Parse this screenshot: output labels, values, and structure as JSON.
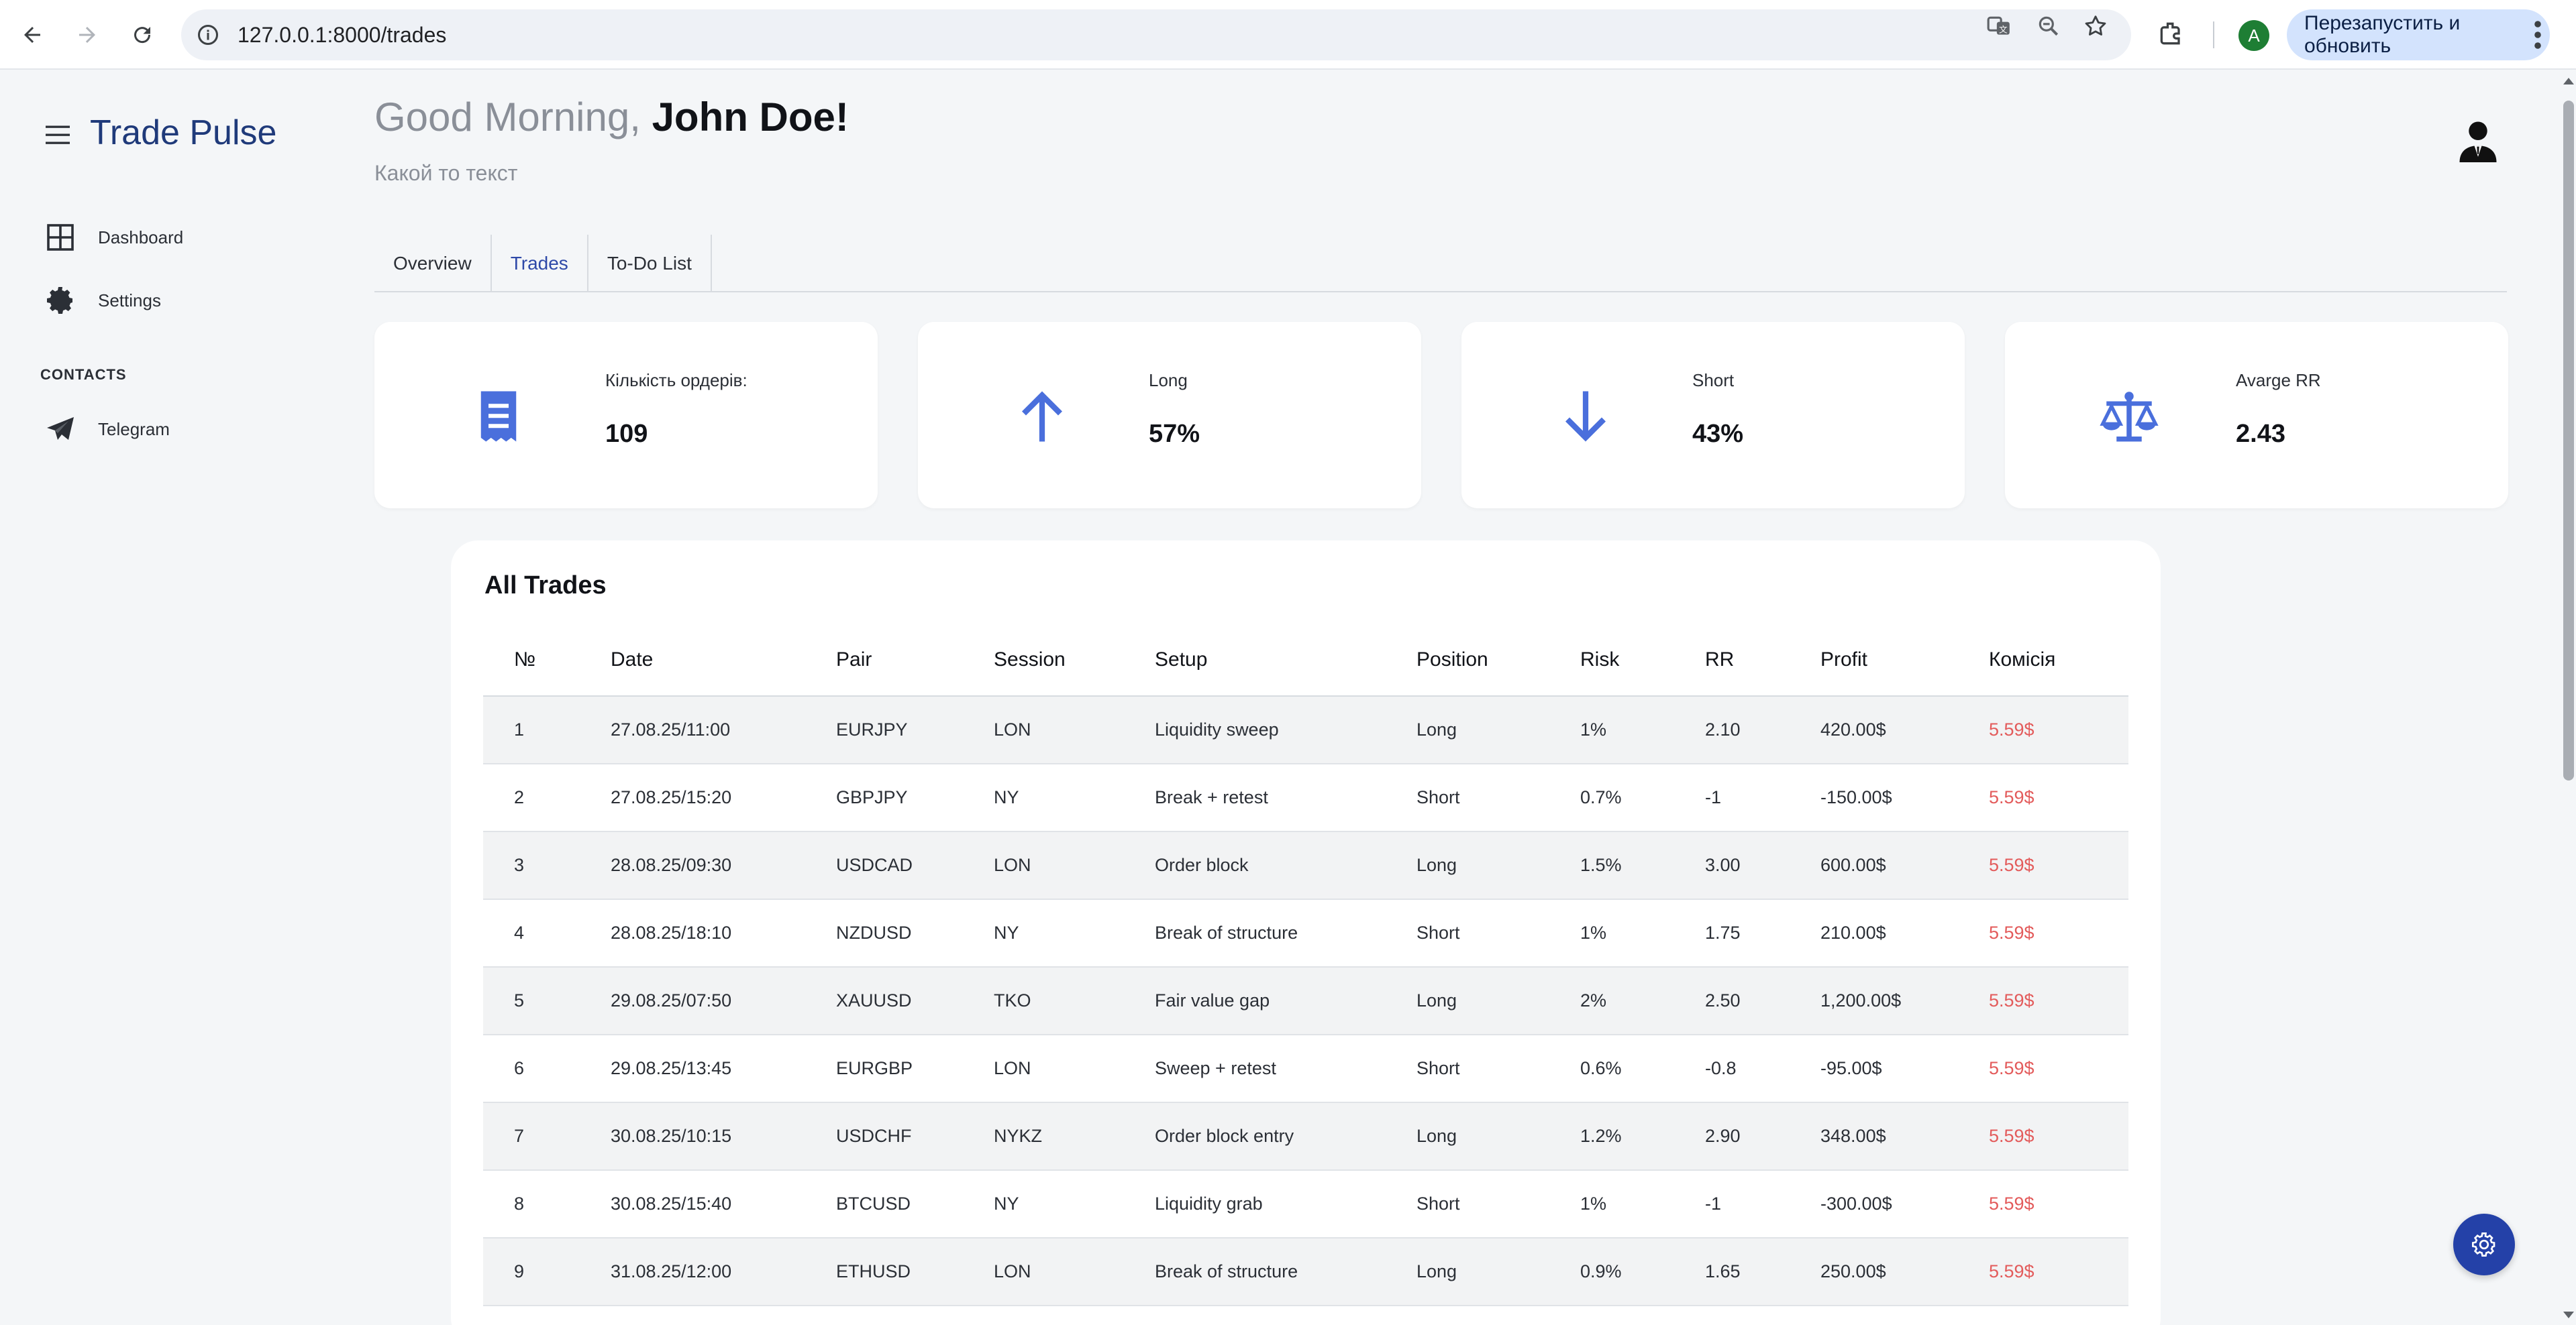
{
  "browser": {
    "url": "127.0.0.1:8000/trades",
    "profile_initial": "A",
    "update_button": "Перезапустить и обновить"
  },
  "sidebar": {
    "brand": "Trade Pulse",
    "items": [
      {
        "label": "Dashboard",
        "icon": "dashboard-icon"
      },
      {
        "label": "Settings",
        "icon": "gear-icon"
      }
    ],
    "contacts_heading": "CONTACTS",
    "contacts": [
      {
        "label": "Telegram",
        "icon": "telegram-icon"
      }
    ]
  },
  "header": {
    "greeting": "Good Morning, ",
    "user_name": "John Doe!",
    "subtitle": "Какой то текст"
  },
  "tabs": [
    {
      "label": "Overview",
      "active": false
    },
    {
      "label": "Trades",
      "active": true
    },
    {
      "label": "To-Do List",
      "active": false
    }
  ],
  "stats": [
    {
      "label": "Кількість ордерів:",
      "value": "109",
      "icon": "receipt-icon"
    },
    {
      "label": "Long",
      "value": "57%",
      "icon": "arrow-up-icon"
    },
    {
      "label": "Short",
      "value": "43%",
      "icon": "arrow-down-icon"
    },
    {
      "label": "Avarge RR",
      "value": "2.43",
      "icon": "scales-icon"
    }
  ],
  "trades": {
    "title": "All Trades",
    "columns": [
      "№",
      "Date",
      "Pair",
      "Session",
      "Setup",
      "Position",
      "Risk",
      "RR",
      "Profit",
      "Комісія"
    ],
    "rows": [
      [
        "1",
        "27.08.25/11:00",
        "EURJPY",
        "LON",
        "Liquidity sweep",
        "Long",
        "1%",
        "2.10",
        "420.00$",
        "5.59$"
      ],
      [
        "2",
        "27.08.25/15:20",
        "GBPJPY",
        "NY",
        "Break + retest",
        "Short",
        "0.7%",
        "-1",
        "-150.00$",
        "5.59$"
      ],
      [
        "3",
        "28.08.25/09:30",
        "USDCAD",
        "LON",
        "Order block",
        "Long",
        "1.5%",
        "3.00",
        "600.00$",
        "5.59$"
      ],
      [
        "4",
        "28.08.25/18:10",
        "NZDUSD",
        "NY",
        "Break of structure",
        "Short",
        "1%",
        "1.75",
        "210.00$",
        "5.59$"
      ],
      [
        "5",
        "29.08.25/07:50",
        "XAUUSD",
        "TKO",
        "Fair value gap",
        "Long",
        "2%",
        "2.50",
        "1,200.00$",
        "5.59$"
      ],
      [
        "6",
        "29.08.25/13:45",
        "EURGBP",
        "LON",
        "Sweep + retest",
        "Short",
        "0.6%",
        "-0.8",
        "-95.00$",
        "5.59$"
      ],
      [
        "7",
        "30.08.25/10:15",
        "USDCHF",
        "NYKZ",
        "Order block entry",
        "Long",
        "1.2%",
        "2.90",
        "348.00$",
        "5.59$"
      ],
      [
        "8",
        "30.08.25/15:40",
        "BTCUSD",
        "NY",
        "Liquidity grab",
        "Short",
        "1%",
        "-1",
        "-300.00$",
        "5.59$"
      ],
      [
        "9",
        "31.08.25/12:00",
        "ETHUSD",
        "LON",
        "Break of structure",
        "Long",
        "0.9%",
        "1.65",
        "250.00$",
        "5.59$"
      ]
    ]
  },
  "colors": {
    "accent": "#2e49a8",
    "icon_blue": "#4a6fdc",
    "fee_red": "#e35b5b",
    "background": "#f4f6f8"
  }
}
